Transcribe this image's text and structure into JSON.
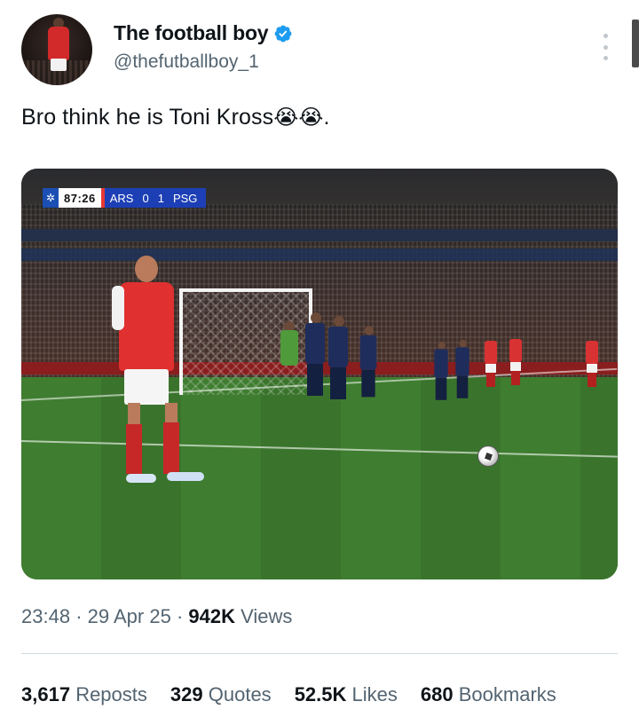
{
  "user": {
    "display_name": "The football boy",
    "handle": "@thefutballboy_1",
    "verified": true
  },
  "tweet": {
    "text": "Bro think he is Toni Kross",
    "emojis": "😭😭",
    "trailing": "."
  },
  "media": {
    "scorebug": {
      "time": "87:26",
      "home": "ARS",
      "home_score": "0",
      "away_score": "1",
      "away": "PSG"
    }
  },
  "meta": {
    "time": "23:48",
    "date": "29 Apr 25",
    "views_count": "942K",
    "views_label": "Views",
    "separator": "·"
  },
  "stats": {
    "reposts": {
      "count": "3,617",
      "label": "Reposts"
    },
    "quotes": {
      "count": "329",
      "label": "Quotes"
    },
    "likes": {
      "count": "52.5K",
      "label": "Likes"
    },
    "bookmarks": {
      "count": "680",
      "label": "Bookmarks"
    }
  },
  "colors": {
    "verified_blue": "#1d9bf0",
    "secondary_text": "#536471",
    "primary_text": "#0f1419"
  },
  "icons": [
    "verified-badge-icon",
    "more-options-icon"
  ]
}
